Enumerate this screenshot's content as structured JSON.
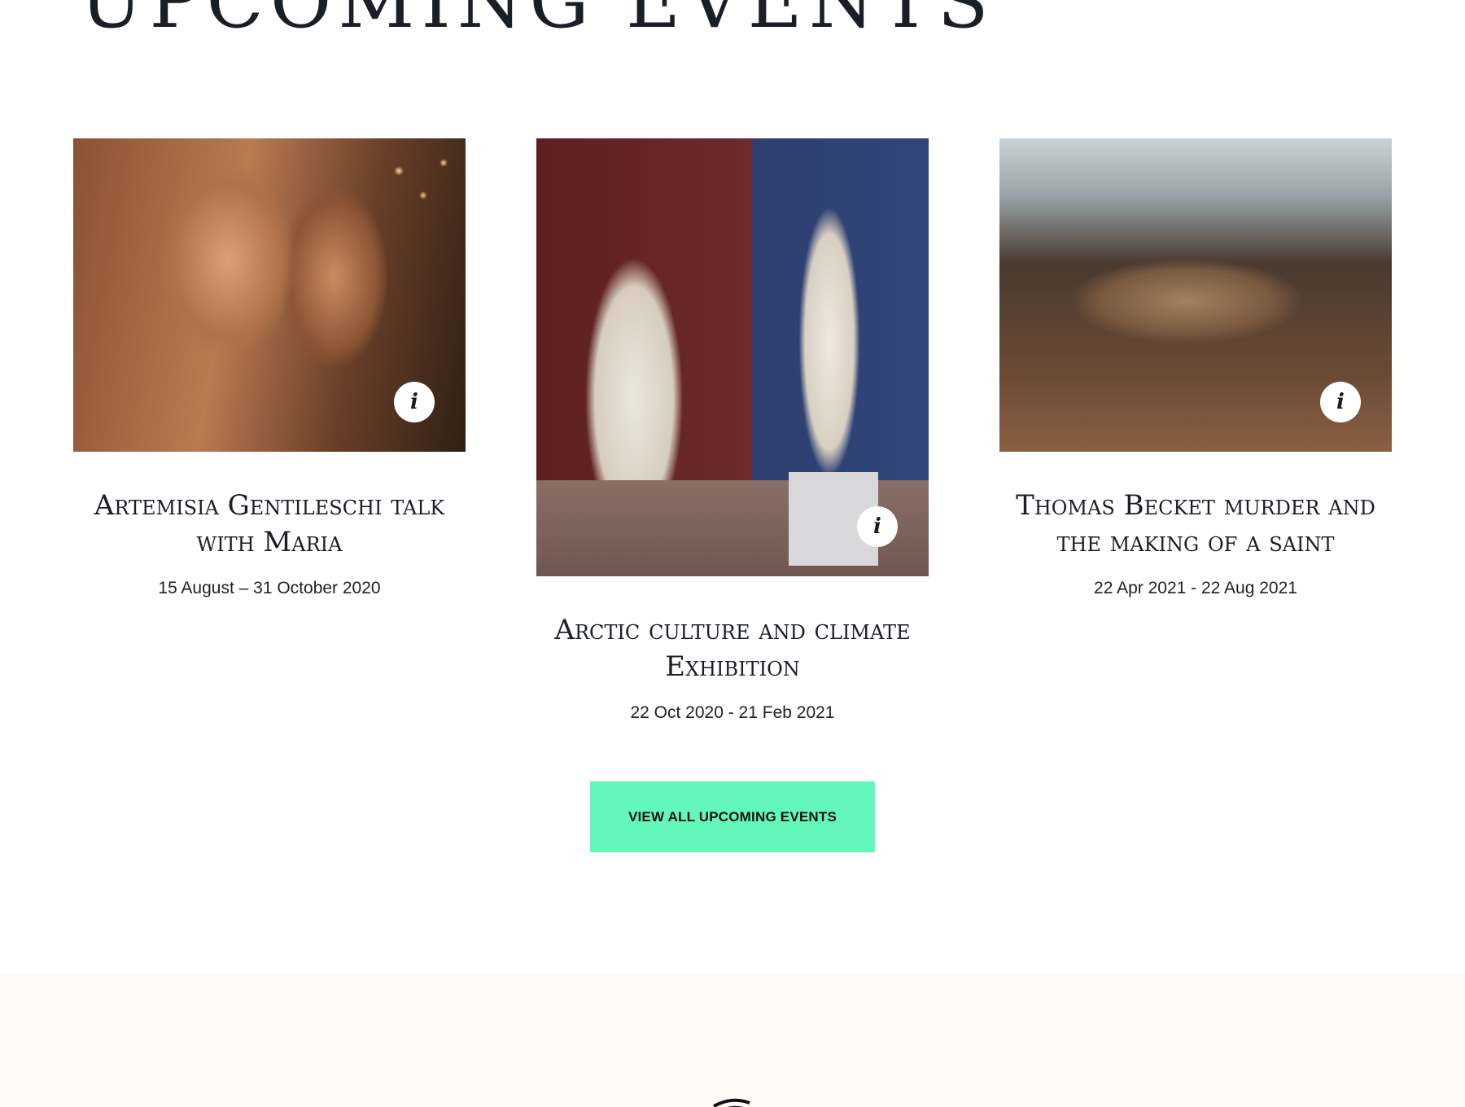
{
  "section": {
    "title": "UPCOMING EVENTS"
  },
  "events": [
    {
      "title": "Artemisia Gentileschi talk with Maria",
      "dates": "15 August – 31 October 2020",
      "info_icon": "info-icon",
      "image": "bust-sculptures-photo"
    },
    {
      "title": "Arctic culture and climate Exhibition",
      "dates": "22 Oct 2020 - 21 Feb 2021",
      "info_icon": "info-icon",
      "image": "museum-statues-photo"
    },
    {
      "title": "Thomas Becket murder and the making of a saint",
      "dates": "22 Apr 2021 - 22 Aug 2021",
      "info_icon": "info-icon",
      "image": "whale-skeleton-photo"
    }
  ],
  "cta": {
    "label": "VIEW ALL UPCOMING EVENTS",
    "color": "#63f7bb"
  },
  "footer": {
    "background": "#fefbf4",
    "logo_icon": "logo-icon"
  }
}
